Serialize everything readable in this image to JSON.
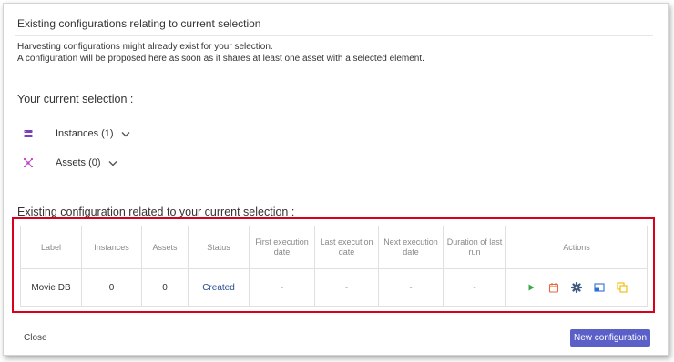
{
  "dialog": {
    "title": "Existing configurations relating to current selection",
    "description_line1": "Harvesting configurations might already exist for your selection.",
    "description_line2": "A configuration will be proposed here as soon as it shares at least one asset with a selected element."
  },
  "selection": {
    "title": "Your current selection :",
    "items": [
      {
        "label": "Instances (1)",
        "icon": "instances-icon",
        "icon_color": "#7b3fbf"
      },
      {
        "label": "Assets (0)",
        "icon": "assets-icon",
        "icon_color": "#c040c8"
      }
    ]
  },
  "configurations": {
    "title": "Existing configuration related to your current selection :",
    "columns": [
      "Label",
      "Instances",
      "Assets",
      "Status",
      "First execution date",
      "Last execution date",
      "Next execution date",
      "Duration of last run",
      "Actions"
    ],
    "rows": [
      {
        "label": "Movie DB",
        "instances": "0",
        "assets": "0",
        "status": "Created",
        "first": "-",
        "last": "-",
        "next": "-",
        "duration": "-"
      }
    ],
    "actions": [
      {
        "name": "run-icon",
        "color": "#3aa845"
      },
      {
        "name": "calendar-icon",
        "color": "#e8663a"
      },
      {
        "name": "gear-icon",
        "color": "#3d5a80"
      },
      {
        "name": "window-icon",
        "color": "#2f6fd0"
      },
      {
        "name": "copy-icon",
        "color": "#f0b800"
      }
    ]
  },
  "footer": {
    "close_label": "Close",
    "new_label": "New configuration",
    "accent": "#5b60c9"
  },
  "highlight_color": "#d9001b"
}
